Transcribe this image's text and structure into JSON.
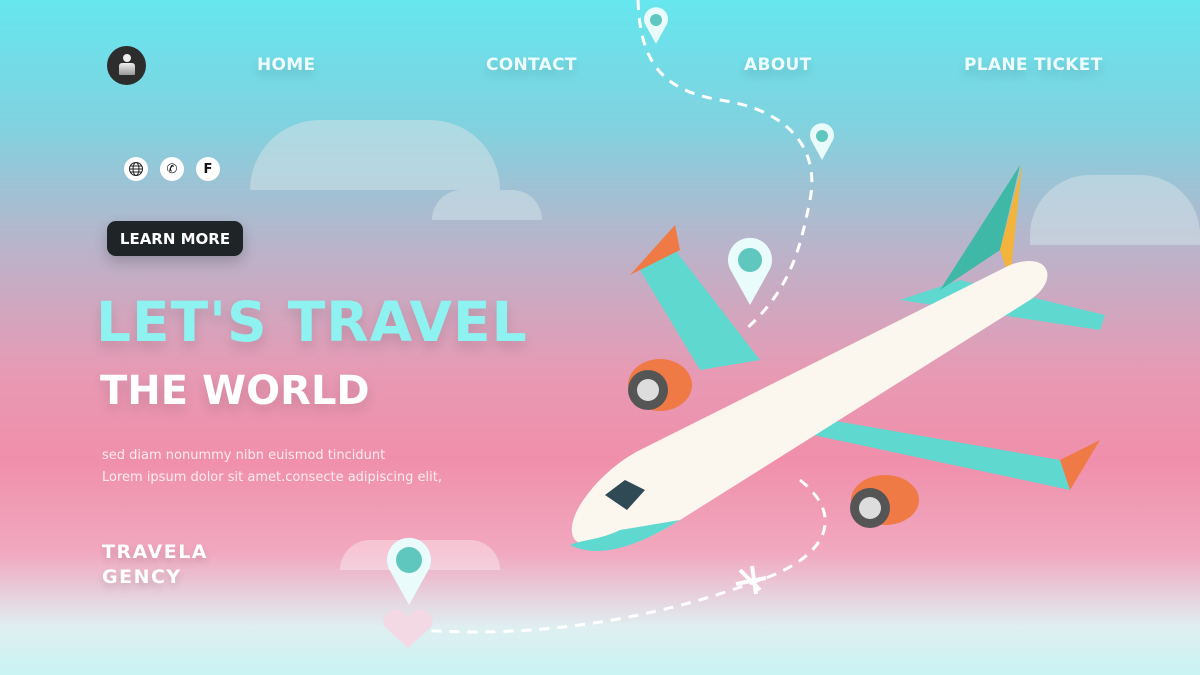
{
  "nav": {
    "items": [
      {
        "label": "HOME"
      },
      {
        "label": "CONTACT"
      },
      {
        "label": "ABOUT"
      },
      {
        "label": "PLANE TICKET"
      }
    ]
  },
  "social": [
    {
      "icon": "globe-icon"
    },
    {
      "icon": "phone-icon",
      "glyph": "✆"
    },
    {
      "icon": "facebook-icon",
      "glyph": "F"
    }
  ],
  "hero": {
    "button": "LEARN MORE",
    "title": "LET'S TRAVEL",
    "subtitle": "THE WORLD",
    "body": [
      "sed diam nonummy nibn euismod tincidunt",
      "Lorem ipsum dolor sit amet.consecte adipiscing elit,"
    ],
    "brand": [
      "TRAVELA",
      "GENCY"
    ]
  },
  "colors": {
    "accent": "#8ef2f0",
    "button": "#1f2427",
    "teal": "#5fd8cf",
    "orange": "#ef7a46"
  }
}
